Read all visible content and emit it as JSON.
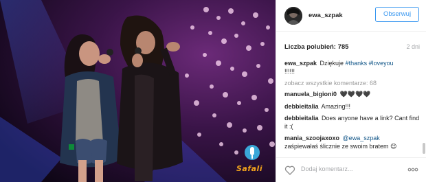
{
  "post": {
    "username": "ewa_szpak",
    "follow_label": "Obserwuj",
    "likes": "Liczba polubień: 785",
    "age": "2 dni",
    "caption": {
      "user": "ewa_szpak",
      "text_prefix": "Dziękuje ",
      "tag1": "#thanks",
      "tag2": "#loveyou",
      "text_suffix": "!!!!!!"
    },
    "view_all": "zobacz wszystkie komentarze: 68",
    "comments": [
      {
        "user": "manuela_bigioni0",
        "text": "🖤🖤🖤🖤"
      },
      {
        "user": "debbieitalia",
        "text": "Amazing!!!"
      },
      {
        "user": "debbieitalia",
        "text": "Does anyone have a link? Cant find it :("
      },
      {
        "user": "mania_szoojaxoxo",
        "mention": "@ewa_szpak",
        "text": "zaśpiewałaś ślicznie ze swoim bratem 😊"
      }
    ],
    "add_comment_placeholder": "Dodaj komentarz...",
    "photo_logo_text": "Safali"
  },
  "colors": {
    "accent": "#3897f0",
    "link": "#125688",
    "muted": "#a5a7aa",
    "logo": "#f0a21c"
  },
  "icons": {
    "like": "heart-outline-icon",
    "more": "ellipsis-icon"
  }
}
